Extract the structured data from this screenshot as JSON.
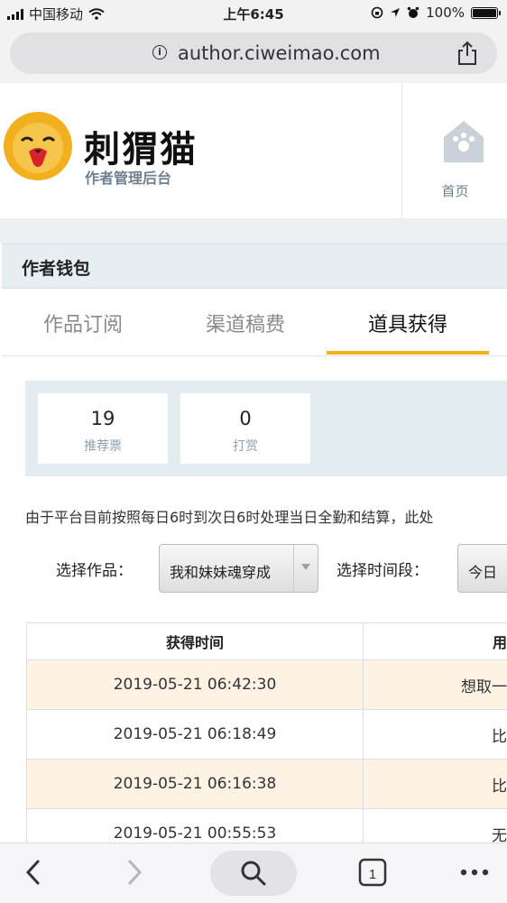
{
  "status_bar": {
    "carrier": "中国移动",
    "time": "上午6:45",
    "battery_percent": "100%",
    "battery_level": 1.0
  },
  "browser": {
    "url": "author.ciweimao.com"
  },
  "site": {
    "brand": "刺猬猫",
    "subtitle": "作者管理后台",
    "home_label": "首页"
  },
  "wallet": {
    "title": "作者钱包",
    "tabs": [
      {
        "label": "作品订阅",
        "active": false
      },
      {
        "label": "渠道稿费",
        "active": false
      },
      {
        "label": "道具获得",
        "active": true
      }
    ],
    "stats": [
      {
        "value": "19",
        "label": "推荐票"
      },
      {
        "value": "0",
        "label": "打赏"
      }
    ],
    "notice": "由于平台目前按照每日6时到次日6时处理当日全勤和结算，此处",
    "filters": {
      "work_label": "选择作品：",
      "work_value": "我和妹妹魂穿成",
      "period_label": "选择时间段：",
      "period_value": "今日"
    },
    "table": {
      "headers": [
        "获得时间",
        "用"
      ],
      "rows": [
        {
          "time": "2019-05-21 06:42:30",
          "note": "想取一"
        },
        {
          "time": "2019-05-21 06:18:49",
          "note": "比"
        },
        {
          "time": "2019-05-21 06:16:38",
          "note": "比"
        },
        {
          "time": "2019-05-21 00:55:53",
          "note": "无"
        }
      ]
    }
  },
  "icons": {
    "wifi": "wifi-icon",
    "info": "info-icon",
    "share": "share-icon",
    "home": "home-icon",
    "back": "back-chevron-icon",
    "forward": "forward-chevron-icon",
    "search": "search-icon",
    "tabs": "tabs-icon",
    "more": "more-icon"
  },
  "colors": {
    "accent": "#f1b318",
    "row_highlight": "#fdf2e3",
    "panel": "#e3edf1"
  }
}
